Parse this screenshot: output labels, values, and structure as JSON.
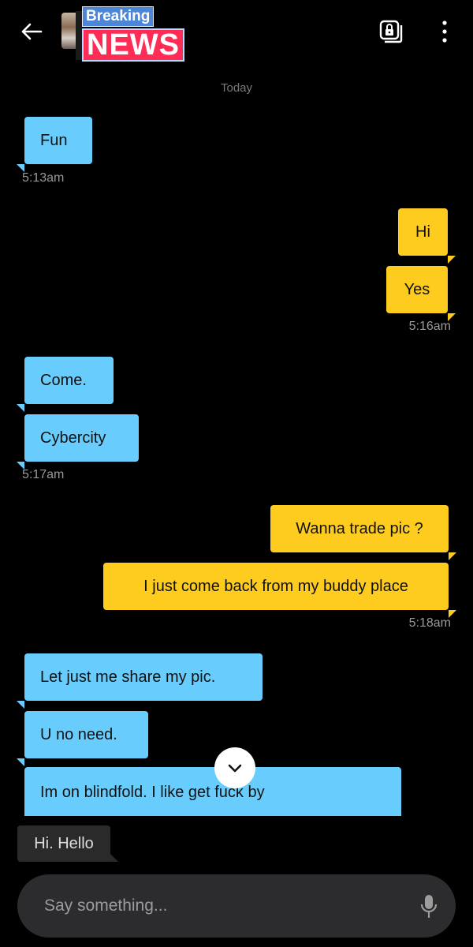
{
  "header": {
    "brand_top": "Breaking",
    "brand_bottom": "NEWS"
  },
  "date_separator": "Today",
  "messages": [
    {
      "dir": "in",
      "text": "Fun"
    },
    {
      "dir": "out",
      "text": "Hi"
    },
    {
      "dir": "out",
      "text": "Yes"
    },
    {
      "dir": "in",
      "text": "Come."
    },
    {
      "dir": "in",
      "text": "Cybercity"
    },
    {
      "dir": "out",
      "text": "Wanna trade pic ?"
    },
    {
      "dir": "out",
      "text": "I just come back from my buddy place"
    },
    {
      "dir": "in",
      "text": "Let just me share my pic."
    },
    {
      "dir": "in",
      "text": "U no need."
    },
    {
      "dir": "in",
      "text": "Im on blindfold. I like get fuck by"
    }
  ],
  "timestamps": [
    "5:13am",
    "5:16am",
    "5:17am",
    "5:18am"
  ],
  "quick_reply": "Hi. Hello",
  "composer": {
    "placeholder": "Say something..."
  },
  "colors": {
    "incoming": "#68cdfc",
    "outgoing": "#fecb1f",
    "background": "#000000"
  },
  "icons": {
    "back": "arrow-left-icon",
    "lock": "album-lock-icon",
    "menu": "more-vertical-icon",
    "scroll": "chevron-down-icon",
    "mic": "microphone-icon"
  }
}
